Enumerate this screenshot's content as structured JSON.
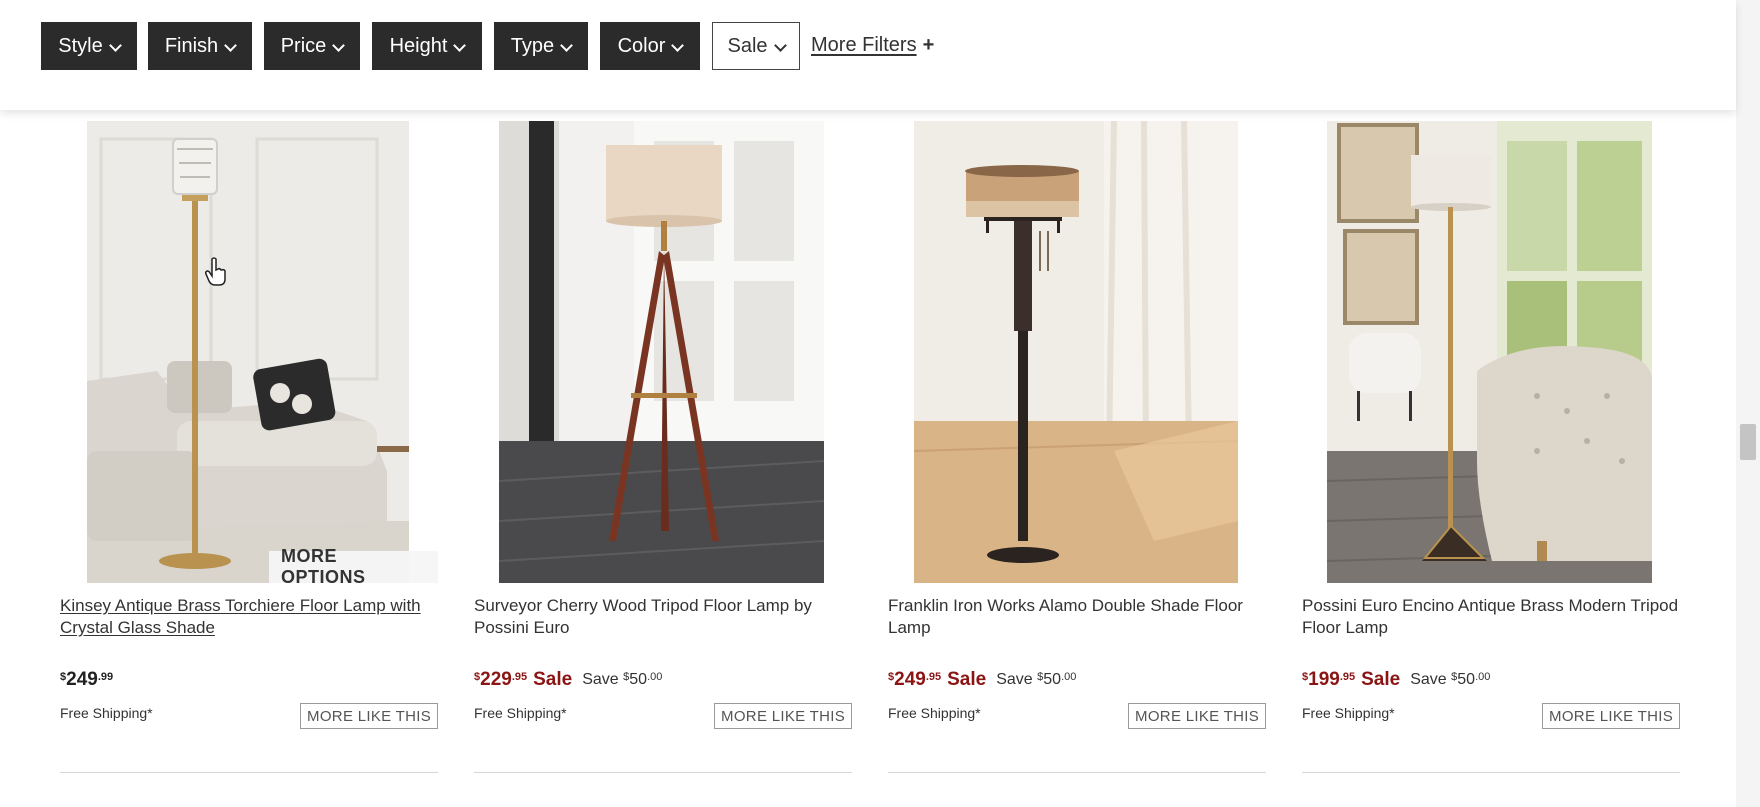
{
  "filters": [
    {
      "label": "Style"
    },
    {
      "label": "Finish"
    },
    {
      "label": "Price"
    },
    {
      "label": "Height"
    },
    {
      "label": "Type"
    },
    {
      "label": "Color"
    },
    {
      "label": "Sale"
    }
  ],
  "more_filters": {
    "label": "More Filters",
    "icon": "plus-icon",
    "symbol": "+"
  },
  "products": [
    {
      "title": "Kinsey Antique Brass Torchiere Floor Lamp with Crystal Glass Shade",
      "more_options": "MORE OPTIONS",
      "price": {
        "currency": "$",
        "dollars": "249",
        "cents": ".99"
      },
      "sale_label": "",
      "save": null,
      "shipping": "Free Shipping*",
      "more_like_this": "MORE LIKE THIS"
    },
    {
      "title": "Surveyor Cherry Wood Tripod Floor Lamp by Possini Euro",
      "price": {
        "currency": "$",
        "dollars": "229",
        "cents": ".95"
      },
      "sale_label": "Sale",
      "save": {
        "text": "Save ",
        "currency": "$",
        "dollars": "50",
        "cents": ".00"
      },
      "shipping": "Free Shipping*",
      "more_like_this": "MORE LIKE THIS"
    },
    {
      "title": "Franklin Iron Works Alamo Double Shade Floor Lamp",
      "price": {
        "currency": "$",
        "dollars": "249",
        "cents": ".95"
      },
      "sale_label": "Sale",
      "save": {
        "text": "Save ",
        "currency": "$",
        "dollars": "50",
        "cents": ".00"
      },
      "shipping": "Free Shipping*",
      "more_like_this": "MORE LIKE THIS"
    },
    {
      "title": "Possini Euro Encino Antique Brass Modern Tripod Floor Lamp",
      "price": {
        "currency": "$",
        "dollars": "199",
        "cents": ".95"
      },
      "sale_label": "Sale",
      "save": {
        "text": "Save ",
        "currency": "$",
        "dollars": "50",
        "cents": ".00"
      },
      "shipping": "Free Shipping*",
      "more_like_this": "MORE LIKE THIS"
    }
  ],
  "colors": {
    "filter_dark": "#2b2b2b",
    "sale_red": "#8b1515"
  },
  "icons": {
    "cursor": "hand-pointer-icon",
    "chevron": "chevron-down-icon"
  }
}
